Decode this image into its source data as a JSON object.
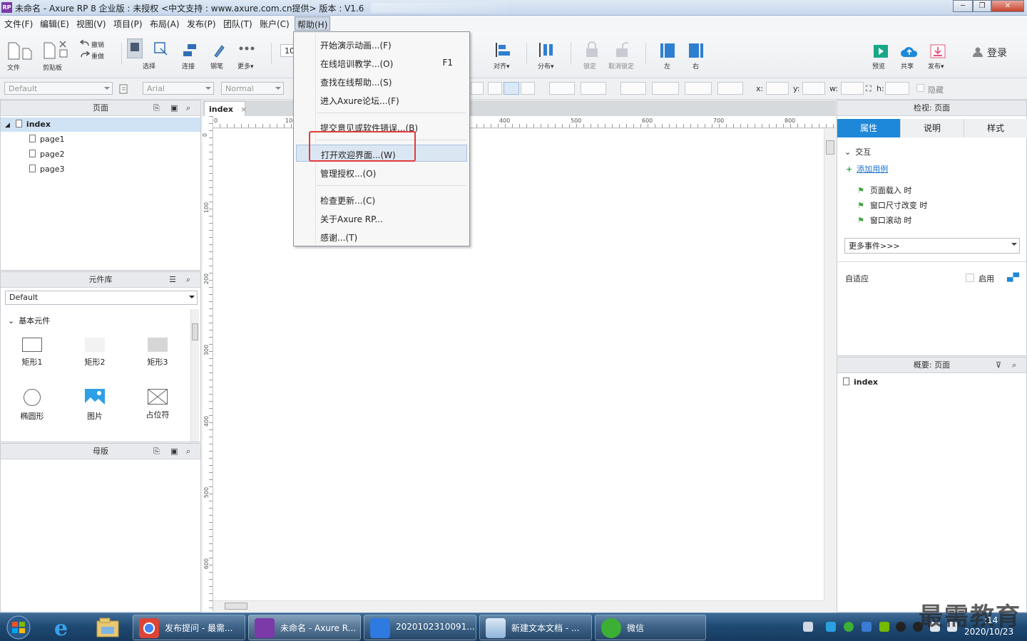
{
  "window": {
    "title": "未命名 - Axure RP 8 企业版 : 未授权     <中文支持 : www.axure.com.cn提供> 版本 : V1.6",
    "minimize": "─",
    "maximize": "❐",
    "close": "✕"
  },
  "menubar": [
    "文件(F)",
    "编辑(E)",
    "视图(V)",
    "项目(P)",
    "布局(A)",
    "发布(P)",
    "团队(T)",
    "账户(C)",
    "帮助(H)"
  ],
  "toolbar": {
    "file": "文件",
    "clipboard": "剪贴板",
    "undo": "撤销",
    "redo": "重做",
    "select": "选择",
    "connect": "连接",
    "pen": "钢笔",
    "more": "更多▾",
    "zoom": "10",
    "align": "对齐▾",
    "distribute": "分布▾",
    "lock": "锁定",
    "unlock": "取消锁定",
    "left": "左",
    "right": "右",
    "preview": "预览",
    "share": "共享",
    "publish": "发布▾",
    "login": "登录"
  },
  "formatbar": {
    "style": "Default",
    "font": "Arial",
    "weight": "Normal",
    "x_label": "x:",
    "y_label": "y:",
    "w_label": "w:",
    "h_label": "h:",
    "hide": "隐藏"
  },
  "pages_panel": {
    "title": "页面",
    "root": "index",
    "children": [
      "page1",
      "page2",
      "page3"
    ]
  },
  "library_panel": {
    "title": "元件库",
    "selected": "Default",
    "category": "基本元件",
    "widgets": [
      "矩形1",
      "矩形2",
      "矩形3",
      "椭圆形",
      "图片",
      "占位符"
    ]
  },
  "masters_panel": {
    "title": "母版"
  },
  "canvas": {
    "tab": "index",
    "tab_close": "×",
    "ruler_h": [
      "0",
      "100",
      "400",
      "500",
      "600",
      "700",
      "800"
    ],
    "ruler_v": [
      "0",
      "100",
      "200",
      "300",
      "400",
      "500",
      "600"
    ]
  },
  "inspector": {
    "title": "检视: 页面",
    "tabs": [
      "属性",
      "说明",
      "样式"
    ],
    "section": "交互",
    "add_case": "添加用例",
    "events": [
      "页面载入 时",
      "窗口尺寸改变 时",
      "窗口滚动 时"
    ],
    "more_events": "更多事件>>>",
    "adaptive": "自适应",
    "enable": "启用"
  },
  "outline_panel": {
    "title": "概要: 页面",
    "item": "index"
  },
  "help_menu": {
    "items": [
      {
        "label": "开始演示动画...(F)",
        "shortcut": ""
      },
      {
        "label": "在线培训教学...(O)",
        "shortcut": "F1"
      },
      {
        "label": "查找在线帮助...(S)",
        "shortcut": ""
      },
      {
        "label": "进入Axure论坛...(F)",
        "shortcut": ""
      },
      {
        "label": "提交意见或软件错误...(B)",
        "shortcut": ""
      },
      {
        "label": "打开欢迎界面...(W)",
        "shortcut": ""
      },
      {
        "label": "管理授权...(O)",
        "shortcut": ""
      },
      {
        "label": "检查更新...(C)",
        "shortcut": ""
      },
      {
        "label": "关于Axure RP...",
        "shortcut": ""
      },
      {
        "label": "感谢...(T)",
        "shortcut": ""
      }
    ],
    "highlighted": "打开欢迎界面...(W)"
  },
  "taskbar": {
    "buttons": [
      "发布提问 - 最需...",
      "未命名 - Axure R...",
      "2020102310091...",
      "新建文本文档 - ...",
      "微信"
    ],
    "time": ":14",
    "date": "2020/10/23"
  },
  "watermark": "最需教育",
  "colors": {
    "accent": "#1e88d8",
    "highlight_box": "#e23b3b"
  }
}
